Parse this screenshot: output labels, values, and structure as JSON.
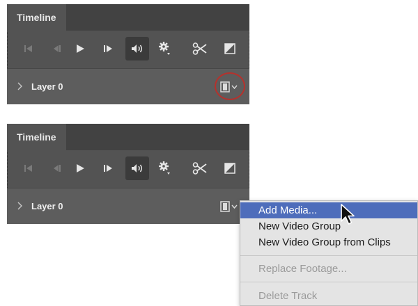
{
  "panels": [
    {
      "tab_label": "Timeline",
      "layer_label": "Layer 0",
      "button_highlighted": true
    },
    {
      "tab_label": "Timeline",
      "layer_label": "Layer 0",
      "button_highlighted": false
    }
  ],
  "controls": [
    "go-to-first-frame-icon",
    "previous-frame-icon",
    "play-icon",
    "next-frame-icon",
    "audio-icon",
    "settings-icon",
    "split-icon",
    "transition-icon"
  ],
  "menu": {
    "items": [
      {
        "label": "Add Media...",
        "state": "highlighted"
      },
      {
        "label": "New Video Group",
        "state": "enabled"
      },
      {
        "label": "New Video Group from Clips",
        "state": "enabled"
      },
      {
        "label": "Replace Footage...",
        "state": "disabled"
      },
      {
        "label": "Delete Track",
        "state": "disabled"
      }
    ]
  },
  "colors": {
    "panel": "#535353",
    "tabbar": "#424242",
    "layer_row": "#5d5d5d",
    "highlight_circle": "#b6312c",
    "menu_highlight": "#4e6dbb",
    "menu_bg": "#e4e4e4"
  }
}
